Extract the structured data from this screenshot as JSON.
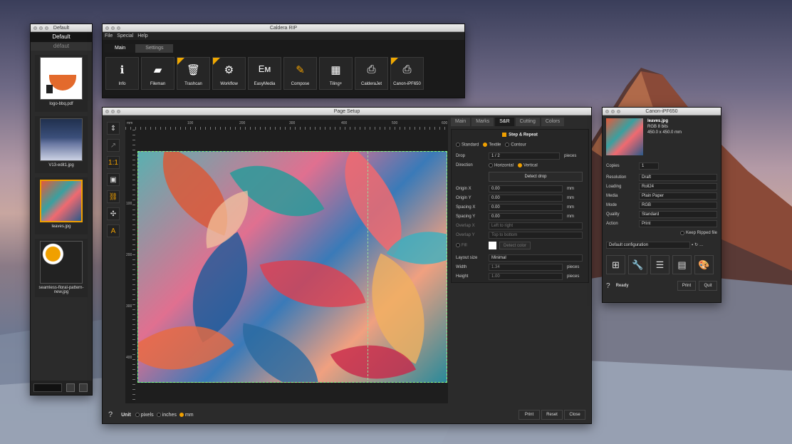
{
  "left_panel": {
    "title": "Default",
    "header": "Default",
    "subheader": "défaut",
    "items": [
      {
        "label": "logo-bbq.pdf"
      },
      {
        "label": "V13-edit1.jpg"
      },
      {
        "label": "leaves.jpg"
      },
      {
        "label": "seamless-floral-pattern-new.jpg"
      }
    ]
  },
  "caldera": {
    "title": "Caldera RIP",
    "menu": [
      "File",
      "Special",
      "Help"
    ],
    "tabs": [
      "Main",
      "Settings"
    ],
    "tools": [
      {
        "label": "Info",
        "icon": "info-icon"
      },
      {
        "label": "Fileman",
        "icon": "folder-icon"
      },
      {
        "label": "Trashcan",
        "icon": "trash-icon"
      },
      {
        "label": "Workflow",
        "icon": "gears-icon"
      },
      {
        "label": "EasyMedia",
        "icon": "easymedia-icon"
      },
      {
        "label": "Compose",
        "icon": "compose-icon"
      },
      {
        "label": "Tiling+",
        "icon": "tiling-icon"
      },
      {
        "label": "CalderaJet",
        "icon": "printer-icon"
      },
      {
        "label": "Canon-iPF650",
        "icon": "printer-icon"
      }
    ]
  },
  "page_setup": {
    "title": "Page Setup",
    "ruler_ticks": [
      "mm",
      "100",
      "200",
      "300",
      "400",
      "500",
      "600",
      "100",
      "200",
      "300",
      "400"
    ],
    "tabs": [
      "Main",
      "Marks",
      "S&R",
      "Cutting",
      "Colors"
    ],
    "section": "Step & Repeat",
    "modes": [
      "Standard",
      "Textile",
      "Contour"
    ],
    "drop": {
      "label": "Drop",
      "value": "1 / 2",
      "unit": "pieces"
    },
    "direction": {
      "label": "Direction",
      "options": [
        "Horizontal",
        "Vertical"
      ]
    },
    "detect_drop": "Detect drop",
    "fields": [
      {
        "label": "Origin X",
        "value": "0.00",
        "unit": "mm"
      },
      {
        "label": "Origin Y",
        "value": "0.00",
        "unit": "mm"
      },
      {
        "label": "Spacing X",
        "value": "0.00",
        "unit": "mm"
      },
      {
        "label": "Spacing Y",
        "value": "0.00",
        "unit": "mm"
      }
    ],
    "overlap_x": {
      "label": "Overlap X",
      "value": "Left to right"
    },
    "overlap_y": {
      "label": "Overlap Y",
      "value": "Top to bottom"
    },
    "fill": "Fill",
    "detect_color": "Detect color",
    "layout_size": {
      "label": "Layout size",
      "value": "Minimal"
    },
    "width": {
      "label": "Width",
      "value": "1.34",
      "unit": "pieces"
    },
    "height": {
      "label": "Height",
      "value": "1.00",
      "unit": "pieces"
    },
    "unit_label": "Unit",
    "units": [
      "pixels",
      "inches",
      "mm"
    ],
    "help": "?",
    "buttons": [
      "Print",
      "Reset",
      "Close"
    ]
  },
  "canon": {
    "title": "Canon-iPF650",
    "file_name": "leaves.jpg",
    "file_info1": "RGB 8 bits",
    "file_info2": "450.0 x 450.0 mm",
    "copies": {
      "label": "Copies",
      "value": "1"
    },
    "settings": [
      {
        "label": "Resolution",
        "value": "Draft"
      },
      {
        "label": "Loading",
        "value": "Roll24"
      },
      {
        "label": "Media",
        "value": "Plain Paper"
      },
      {
        "label": "Mode",
        "value": "RGB"
      },
      {
        "label": "Quality",
        "value": "Standard"
      },
      {
        "label": "Action",
        "value": "Print"
      }
    ],
    "keep_ripped": "Keep Ripped file",
    "config": "Default configuration",
    "config_more": "...",
    "help": "?",
    "status": "Ready",
    "print": "Print",
    "quit": "Quit"
  },
  "colors": {
    "accent": "#f0a000",
    "window_bg": "#2d2d2d"
  }
}
